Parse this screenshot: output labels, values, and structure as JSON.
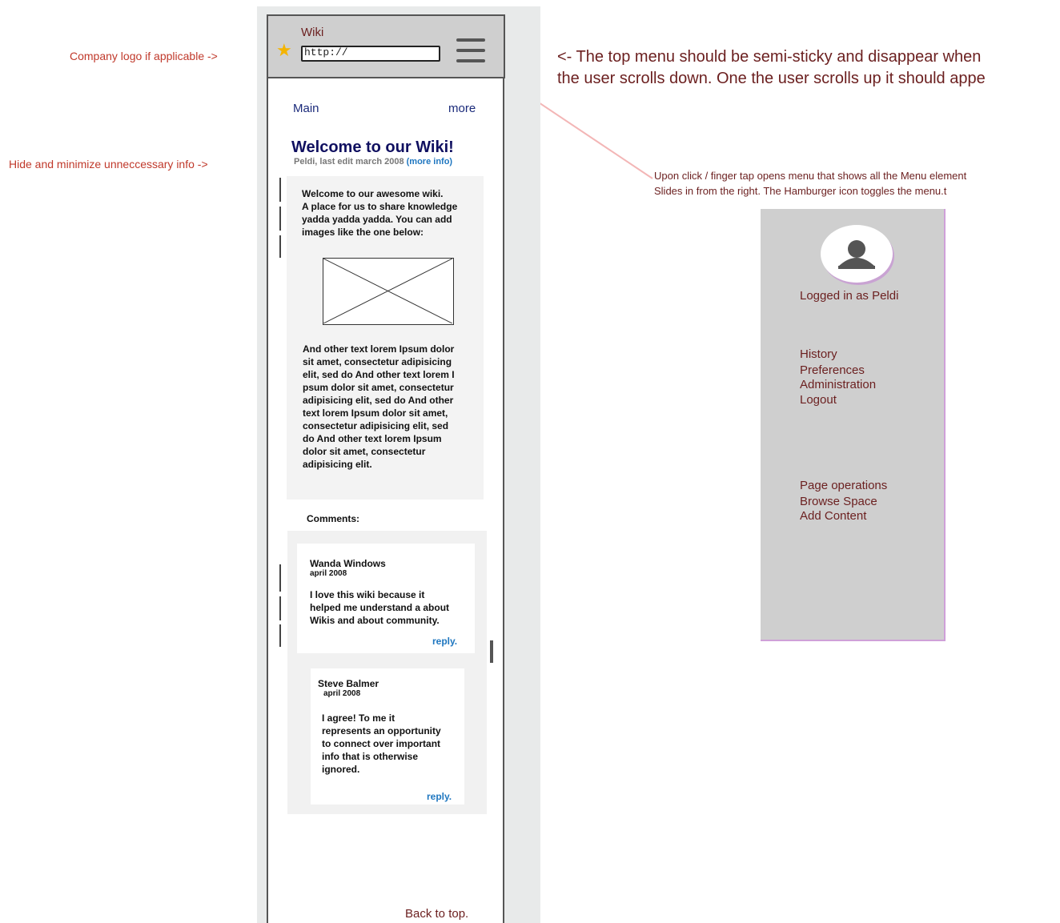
{
  "annotations": {
    "logo_note": "Company logo if applicable ->",
    "hide_note": "Hide and minimize unneccessary info ->",
    "top_menu_line1": "<- The top menu should be semi-sticky and disappear when",
    "top_menu_line2": "the user scrolls down. One the user scrolls up it should appe",
    "menu_note_line1": "Upon click / finger tap opens menu that shows all the Menu element",
    "menu_note_line2": "Slides in from the right. The Hamburger icon toggles the menu.t"
  },
  "topbar": {
    "title": "Wiki",
    "url": "http://"
  },
  "nav": {
    "main": "Main",
    "more": "more"
  },
  "page": {
    "title": "Welcome to our Wiki!",
    "meta": "Peldi, last edit march 2008",
    "more_info": "(more info)",
    "intro_lines": [
      "Welcome to our awesome wiki.",
      "A place for us to share knowledge",
      "yadda yadda yadda. You can add",
      "images like the one below:"
    ],
    "body_lines": [
      "And other text lorem Ipsum dolor",
      "sit amet, consectetur adipisicing",
      "elit, sed do And other text lorem I",
      "psum dolor sit amet, consectetur",
      "adipisicing elit, sed do And other",
      "text lorem Ipsum dolor sit amet,",
      "consectetur adipisicing elit, sed",
      "do And other text lorem Ipsum",
      "dolor sit amet, consectetur",
      "adipisicing elit."
    ]
  },
  "comments": {
    "label": "Comments:",
    "items": [
      {
        "author": "Wanda Windows",
        "date": "april 2008",
        "lines": [
          "I love this wiki because it",
          "helped me understand a about",
          "Wikis and about community."
        ],
        "reply": "reply."
      },
      {
        "author": "Steve Balmer",
        "date": "april 2008",
        "lines": [
          "I agree! To me it",
          "represents an opportunity",
          "to connect over important",
          "info that is otherwise",
          "ignored."
        ],
        "reply": "reply."
      }
    ]
  },
  "back_to_top": "Back to top.",
  "side_menu": {
    "logged_in": "Logged in as Peldi",
    "group1": [
      "History",
      "Preferences",
      "Administration",
      "Logout"
    ],
    "group2": [
      "Page operations",
      "Browse Space",
      "Add Content"
    ]
  }
}
